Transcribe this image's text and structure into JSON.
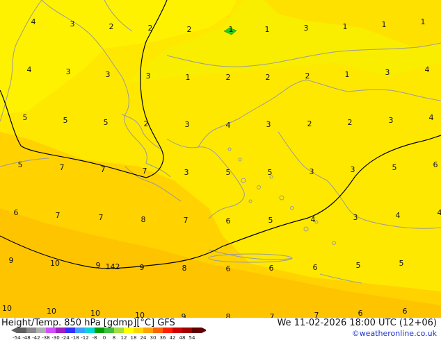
{
  "map": {
    "temperature_labels": [
      {
        "v": "4"
      },
      {
        "v": "3"
      },
      {
        "v": "2"
      },
      {
        "v": "2"
      },
      {
        "v": "2"
      },
      {
        "v": "1"
      },
      {
        "v": "1"
      },
      {
        "v": "3"
      },
      {
        "v": "1"
      },
      {
        "v": "1"
      },
      {
        "v": "1"
      },
      {
        "v": "4"
      },
      {
        "v": "3"
      },
      {
        "v": "3"
      },
      {
        "v": "3"
      },
      {
        "v": "1"
      },
      {
        "v": "2"
      },
      {
        "v": "2"
      },
      {
        "v": "2"
      },
      {
        "v": "1"
      },
      {
        "v": "3"
      },
      {
        "v": "4"
      },
      {
        "v": "5"
      },
      {
        "v": "5"
      },
      {
        "v": "5"
      },
      {
        "v": "2"
      },
      {
        "v": "3"
      },
      {
        "v": "4"
      },
      {
        "v": "3"
      },
      {
        "v": "2"
      },
      {
        "v": "2"
      },
      {
        "v": "3"
      },
      {
        "v": "4"
      },
      {
        "v": "5"
      },
      {
        "v": "7"
      },
      {
        "v": "7"
      },
      {
        "v": "7"
      },
      {
        "v": "3"
      },
      {
        "v": "5"
      },
      {
        "v": "5"
      },
      {
        "v": "3"
      },
      {
        "v": "3"
      },
      {
        "v": "5"
      },
      {
        "v": "6"
      },
      {
        "v": "6"
      },
      {
        "v": "7"
      },
      {
        "v": "7"
      },
      {
        "v": "8"
      },
      {
        "v": "7"
      },
      {
        "v": "6"
      },
      {
        "v": "5"
      },
      {
        "v": "4"
      },
      {
        "v": "3"
      },
      {
        "v": "4"
      },
      {
        "v": "4"
      },
      {
        "v": "9"
      },
      {
        "v": "10"
      },
      {
        "v": "9"
      },
      {
        "v": "142"
      },
      {
        "v": "9"
      },
      {
        "v": "8"
      },
      {
        "v": "6"
      },
      {
        "v": "6"
      },
      {
        "v": "6"
      },
      {
        "v": "5"
      },
      {
        "v": "5"
      },
      {
        "v": "10"
      },
      {
        "v": "10"
      },
      {
        "v": "10"
      },
      {
        "v": "10"
      },
      {
        "v": "9"
      },
      {
        "v": "8"
      },
      {
        "v": "7"
      },
      {
        "v": "7"
      },
      {
        "v": "6"
      },
      {
        "v": "6"
      }
    ]
  },
  "footer": {
    "title": "Height/Temp. 850 hPa [gdmp][°C] GFS",
    "datetime": "We 11-02-2026 18:00 UTC (12+06)",
    "credit": "©weatheronline.co.uk",
    "scale_ticks": [
      "-54",
      "-48",
      "-42",
      "-38",
      "-30",
      "-24",
      "-18",
      "-12",
      "-8",
      "0",
      "8",
      "12",
      "18",
      "24",
      "30",
      "36",
      "42",
      "48",
      "54"
    ],
    "scale_colors": [
      "#606060",
      "#8a8a8a",
      "#b0b0b0",
      "#d050ff",
      "#a020c0",
      "#3030ff",
      "#3aa0ff",
      "#00d8d8",
      "#00a000",
      "#40c040",
      "#a0e040",
      "#ffff00",
      "#ffd700",
      "#ffa500",
      "#ff6000",
      "#ff2000",
      "#d00000",
      "#a00000",
      "#600000"
    ]
  }
}
